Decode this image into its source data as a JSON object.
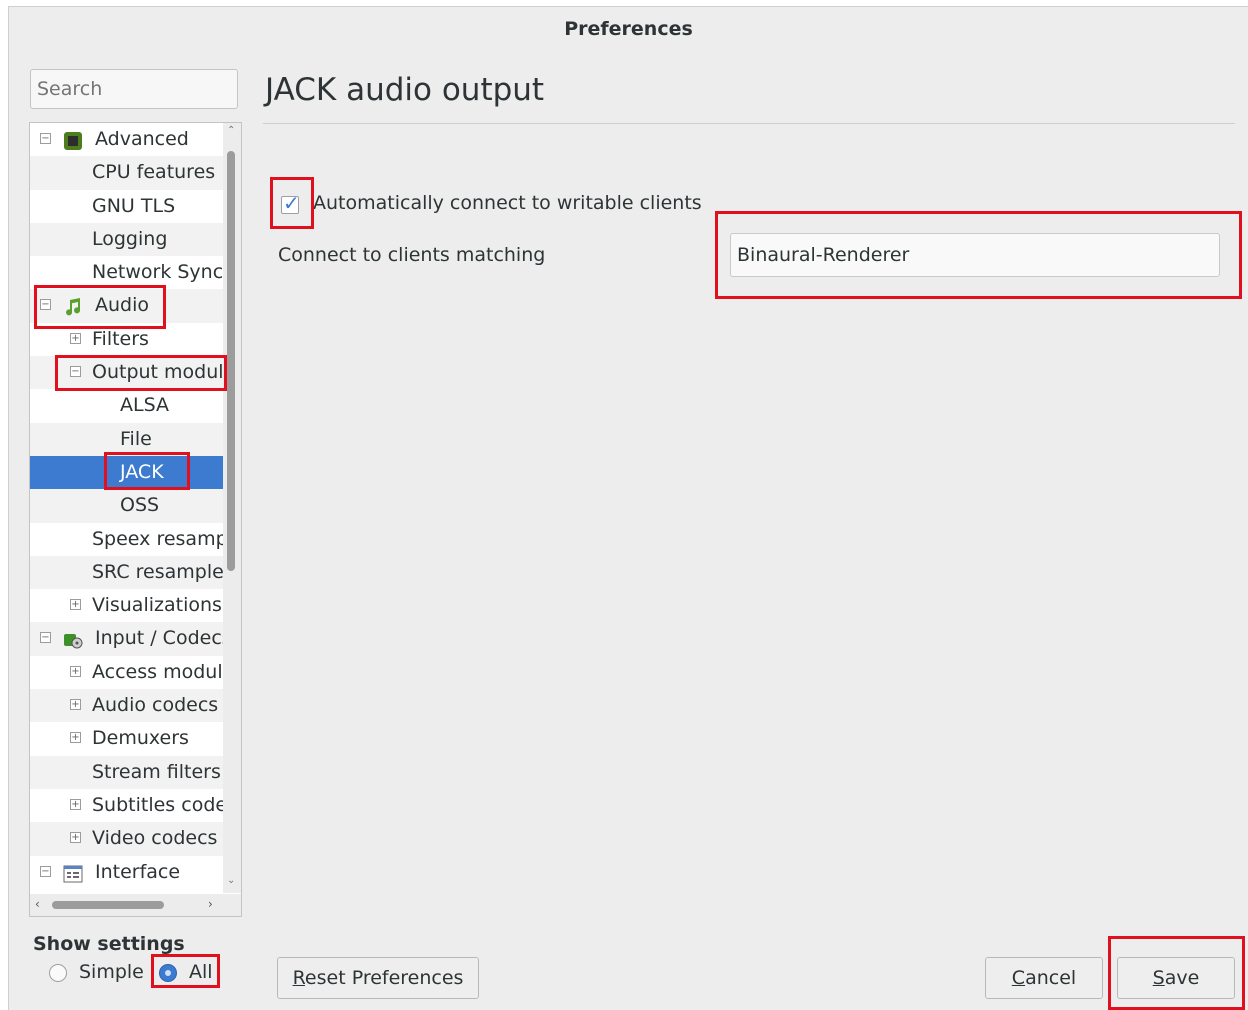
{
  "window": {
    "title": "Preferences"
  },
  "search": {
    "placeholder": "Search"
  },
  "tree": {
    "items": [
      {
        "label": "Advanced",
        "level": 0,
        "expander": "minus",
        "icon": "advanced-chip-icon"
      },
      {
        "label": "CPU features",
        "level": 1
      },
      {
        "label": "GNU TLS",
        "level": 1
      },
      {
        "label": "Logging",
        "level": 1
      },
      {
        "label": "Network Sync",
        "level": 1
      },
      {
        "label": "Audio",
        "level": 0,
        "expander": "minus",
        "icon": "music-note-icon"
      },
      {
        "label": "Filters",
        "level": 1,
        "expander": "plus"
      },
      {
        "label": "Output modules",
        "level": 1,
        "expander": "minus"
      },
      {
        "label": "ALSA",
        "level": 2
      },
      {
        "label": "File",
        "level": 2
      },
      {
        "label": "JACK",
        "level": 2,
        "selected": true
      },
      {
        "label": "OSS",
        "level": 2
      },
      {
        "label": "Speex resampler",
        "level": 1
      },
      {
        "label": "SRC resampler",
        "level": 1
      },
      {
        "label": "Visualizations",
        "level": 1,
        "expander": "plus"
      },
      {
        "label": "Input / Codecs",
        "level": 0,
        "expander": "minus",
        "icon": "codec-icon"
      },
      {
        "label": "Access modules",
        "level": 1,
        "expander": "plus"
      },
      {
        "label": "Audio codecs",
        "level": 1,
        "expander": "plus"
      },
      {
        "label": "Demuxers",
        "level": 1,
        "expander": "plus"
      },
      {
        "label": "Stream filters",
        "level": 1
      },
      {
        "label": "Subtitles codecs",
        "level": 1,
        "expander": "plus"
      },
      {
        "label": "Video codecs",
        "level": 1,
        "expander": "plus"
      },
      {
        "label": "Interface",
        "level": 0,
        "expander": "minus",
        "icon": "interface-window-icon"
      }
    ]
  },
  "main": {
    "heading": "JACK audio output",
    "auto_connect_label": "Automatically connect to writable clients",
    "auto_connect_checked": true,
    "match_label": "Connect to clients matching",
    "match_value": "Binaural-Renderer"
  },
  "footer": {
    "show_settings_label": "Show settings",
    "simple_label": "Simple",
    "all_label": "All",
    "selected_mode": "All",
    "reset_label": "Reset Preferences",
    "cancel_label": "Cancel",
    "save_label": "Save"
  },
  "colors": {
    "selection": "#3d7bd0",
    "highlight_annotation": "#e0101e",
    "window_bg": "#ededed"
  }
}
